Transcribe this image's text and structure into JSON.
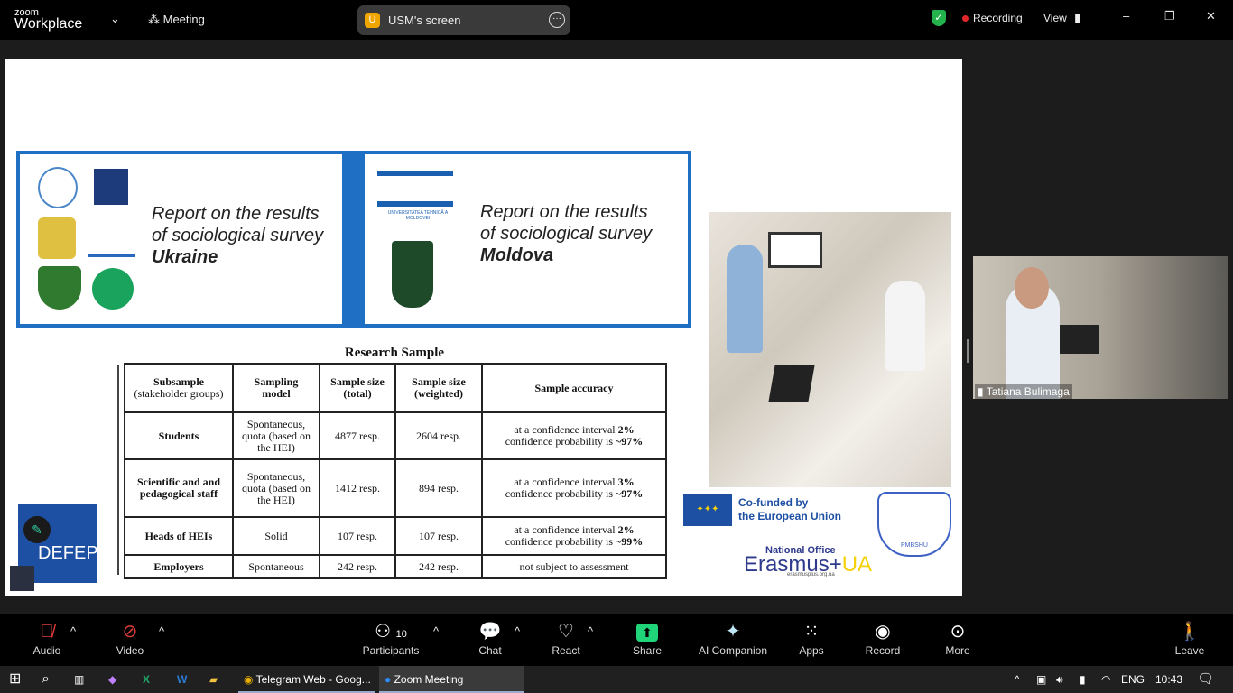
{
  "topbar": {
    "brand_small": "zoom",
    "brand": "Workplace",
    "meeting_label": "Meeting",
    "share_initial": "U",
    "share_label": "USM's screen",
    "recording": "Recording",
    "view": "View"
  },
  "slide": {
    "ukraine": {
      "line1": "Report on the results",
      "line2": "of sociological survey",
      "country": "Ukraine"
    },
    "moldova": {
      "line1": "Report on the results",
      "line2": "of sociological survey",
      "country": "Moldova",
      "logo_text": "UNIVERSITATEA TEHNICĂ A MOLDOVEI"
    },
    "table_title": "Research Sample",
    "headers": [
      [
        "Subsample",
        "(stakeholder groups)"
      ],
      [
        "Sampling",
        "model"
      ],
      [
        "Sample size",
        "(total)"
      ],
      [
        "Sample size",
        "(weighted)"
      ],
      [
        "Sample accuracy",
        ""
      ]
    ],
    "rows": [
      {
        "group": "Students",
        "model": "Spontaneous, quota (based on the HEI)",
        "total": "4877 resp.",
        "weighted": "2604 resp.",
        "acc1": "at a confidence interval ",
        "acc1b": "2%",
        "acc2": "confidence probability is ",
        "acc2b": "~97%"
      },
      {
        "group": "Scientific and and pedagogical staff",
        "model": "Spontaneous, quota (based on the HEI)",
        "total": "1412 resp.",
        "weighted": "894 resp.",
        "acc1": "at a confidence interval ",
        "acc1b": "3%",
        "acc2": "confidence probability is ",
        "acc2b": "~97%"
      },
      {
        "group": "Heads of HEIs",
        "model": "Solid",
        "total": "107 resp.",
        "weighted": "107 resp.",
        "acc1": "at a confidence interval ",
        "acc1b": "2%",
        "acc2": "confidence probability is ",
        "acc2b": "~99%"
      },
      {
        "group": "Employers",
        "model": "Spontaneous",
        "total": "242 resp.",
        "weighted": "242 resp.",
        "acc1": "not subject to assessment",
        "acc1b": "",
        "acc2": "",
        "acc2b": ""
      }
    ],
    "eu_text1": "Co-funded by",
    "eu_text2": "the European Union",
    "erasmus_office": "National Office",
    "erasmus": "Erasmus+",
    "erasmus_ua": "UA",
    "erasmus_url": "erasmusplus.org.ua",
    "pmbshu": "PMBSHU",
    "defep": "DEFEP"
  },
  "video": {
    "name": "Tatiana Bulimaga"
  },
  "toolbar": {
    "audio": "Audio",
    "video": "Video",
    "participants": "Participants",
    "participants_count": "10",
    "chat": "Chat",
    "react": "React",
    "share": "Share",
    "ai": "AI Companion",
    "apps": "Apps",
    "record": "Record",
    "more": "More",
    "leave": "Leave"
  },
  "taskbar": {
    "chrome": "Telegram Web - Goog...",
    "zoom": "Zoom Meeting",
    "lang": "ENG",
    "time": "10:43"
  },
  "colors": {
    "slide_blue": "#1f6fc5",
    "share_green": "#20d47a",
    "recording_red": "#e02828"
  }
}
